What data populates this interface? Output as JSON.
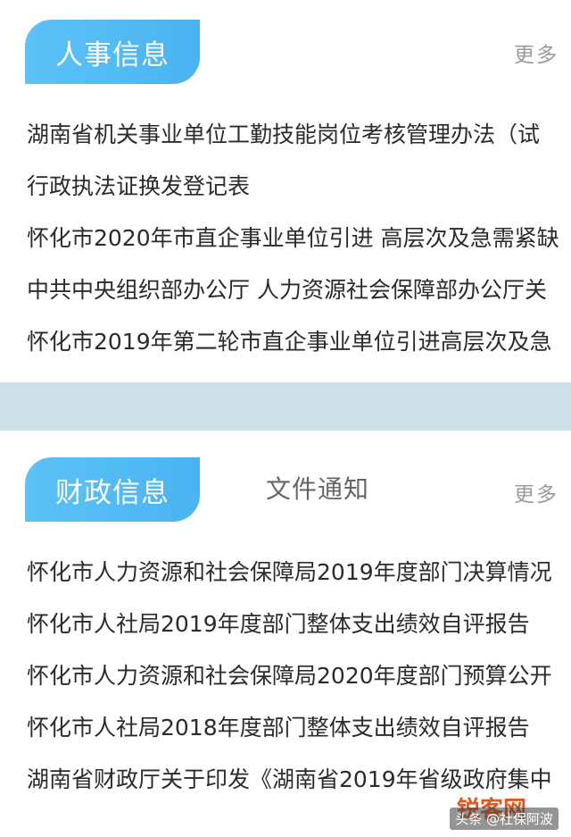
{
  "hr_section": {
    "tab_label": "人事信息",
    "more_label": "更多",
    "items": [
      "湖南省机关事业单位工勤技能岗位考核管理办法（试",
      "行政执法证换发登记表",
      "怀化市2020年市直企事业单位引进 高层次及急需紧缺",
      "中共中央组织部办公厅 人力资源社会保障部办公厅关",
      "怀化市2019年第二轮市直企事业单位引进高层次及急"
    ]
  },
  "finance_section": {
    "tab_active_label": "财政信息",
    "tab_inactive_label": "文件通知",
    "more_label": "更多",
    "items": [
      "怀化市人力资源和社会保障局2019年度部门决算情况",
      "怀化市人社局2019年度部门整体支出绩效自评报告",
      "怀化市人力资源和社会保障局2020年度部门预算公开",
      "怀化市人社局2018年度部门整体支出绩效自评报告",
      "湖南省财政厅关于印发《湖南省2019年省级政府集中"
    ]
  },
  "watermark": {
    "text": "头条 @社保阿波",
    "logo_text": "锐客网"
  },
  "colors": {
    "tab_active": "#4fb8f4",
    "divider": "#cfe0ea",
    "more_text": "#9a9a9a"
  }
}
